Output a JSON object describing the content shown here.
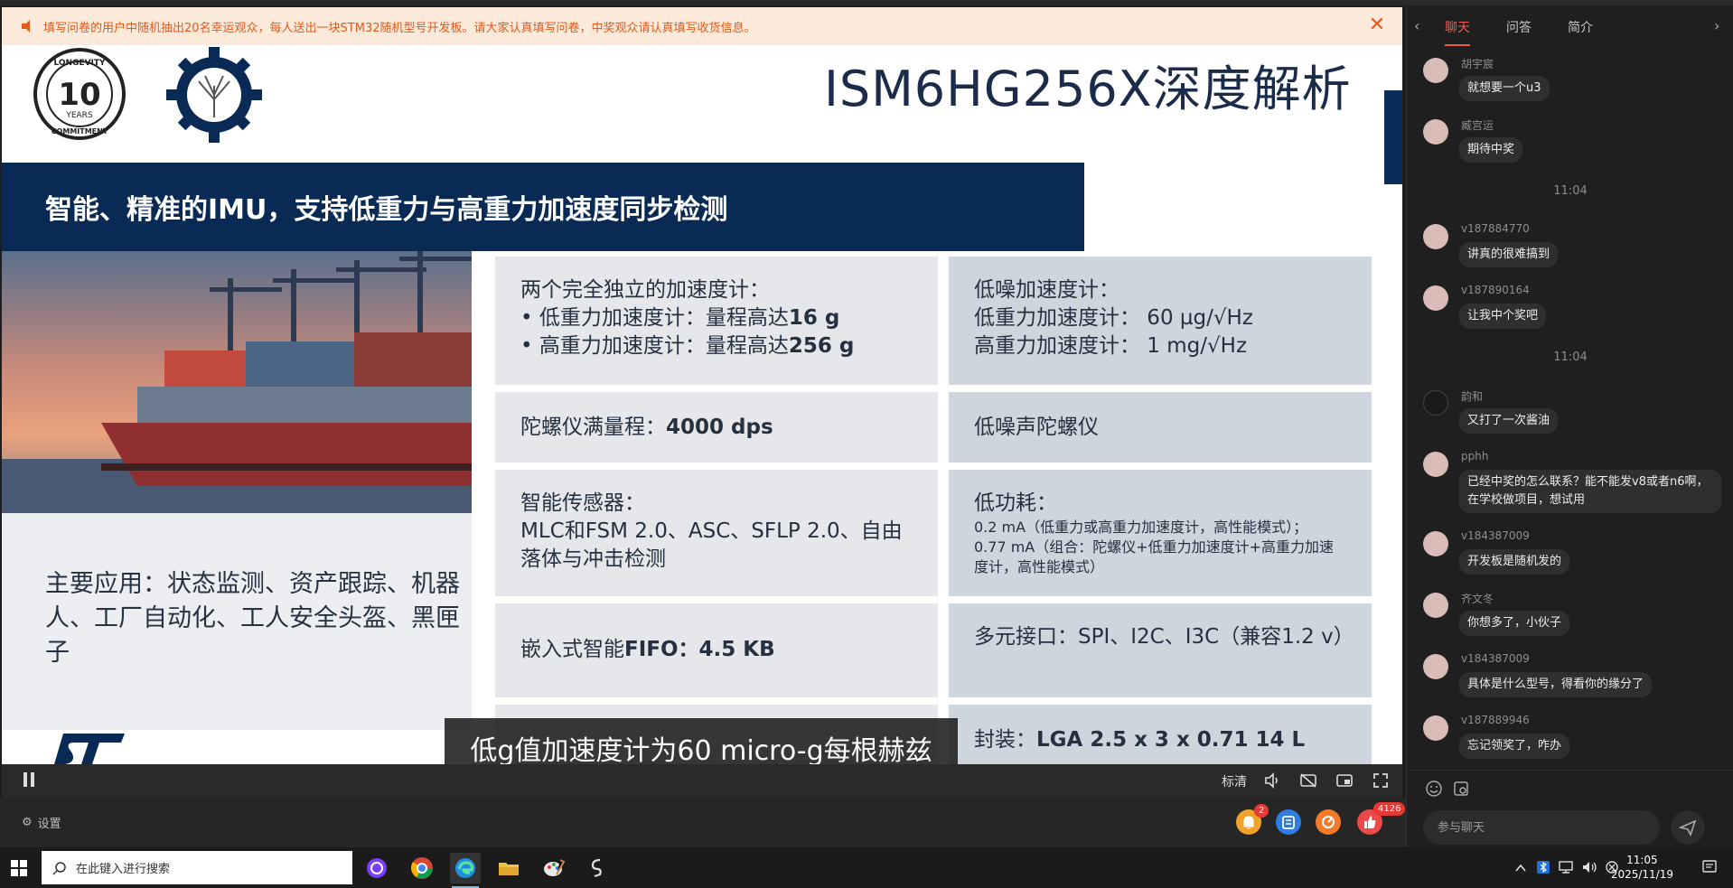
{
  "notice": {
    "text": "填写问卷的用户中随机抽出20名幸运观众，每人送出一块STM32随机型号开发板。请大家认真填写问卷，中奖观众请认真填写收货信息。"
  },
  "slide": {
    "logo_text_top": "LONGEVITY",
    "logo_number": "10",
    "logo_years": "YEARS",
    "logo_text_bottom": "COMMITMENT",
    "title": "ISM6HG256X深度解析",
    "banner": "智能、精准的IMU，支持低重力与高重力加速度同步检测",
    "applications": "主要应用：状态监测、资产跟踪、机器人、工厂自动化、工人安全头盔、黑匣子",
    "cells": {
      "c1_head": "两个完全独立的加速度计：",
      "c1_l1_pre": "•   低重力加速度计：量程高达",
      "c1_l1_val": "16 g",
      "c1_l2_pre": "•   高重力加速度计：量程高达",
      "c1_l2_val": "256 g",
      "c2_l1": "低噪加速度计：",
      "c2_l2": "低重力加速度计：  60 µg/√Hz",
      "c2_l3": "高重力加速度计：    1 mg/√Hz",
      "c3_pre": "陀螺仪满量程：",
      "c3_val": "4000 dps",
      "c4": "低噪声陀螺仪",
      "c5_head": "智能传感器：",
      "c5_body": "MLC和FSM 2.0、ASC、SFLP 2.0、自由落体与冲击检测",
      "c6_head": "低功耗：",
      "c6_l1": "0.2 mA（低重力或高重力加速度计，高性能模式）；",
      "c6_l2": "0.77 mA（组合：陀螺仪+低重力加速度计+高重力加速度计，高性能模式）",
      "c7_pre": "嵌入式智能",
      "c7_val": "FIFO：4.5 KB",
      "c8": "多元接口：SPI、I2C、I3C（兼容1.2 v）",
      "c10_pre": "封装：",
      "c10_val": "LGA 2.5 x 3 x 0.71 14 L"
    }
  },
  "subtitle": "低g值加速度计为60 micro-g每根赫兹",
  "controls": {
    "quality": "标清",
    "settings": "设置",
    "bell_badge": "2",
    "like_badge": "4126"
  },
  "chat": {
    "tabs": [
      "聊天",
      "问答",
      "简介"
    ],
    "messages": [
      {
        "user": "胡宇宸",
        "text": "就想要一个u3"
      },
      {
        "user": "臧宫运",
        "text": "期待中奖"
      },
      {
        "time": "11:04"
      },
      {
        "user": "v187884770",
        "text": "讲真的很难搞到"
      },
      {
        "user": "v187890164",
        "text": "让我中个奖吧"
      },
      {
        "time": "11:04"
      },
      {
        "user": "韵和",
        "text": "又打了一次酱油"
      },
      {
        "user": "pphh",
        "text": "已经中奖的怎么联系？能不能发v8或者n6啊，在学校做项目，想试用"
      },
      {
        "user": "v184387009",
        "text": "开发板是随机发的"
      },
      {
        "user": "齐文冬",
        "text": "你想多了，小伙子"
      },
      {
        "user": "v184387009",
        "text": "具体是什么型号，得看你的缘分了"
      },
      {
        "user": "v187889946",
        "text": "忘记领奖了，咋办"
      }
    ],
    "input_placeholder": "参与聊天"
  },
  "taskbar": {
    "search_placeholder": "在此键入进行搜索",
    "time": "11:05",
    "date": "2025/11/19"
  }
}
